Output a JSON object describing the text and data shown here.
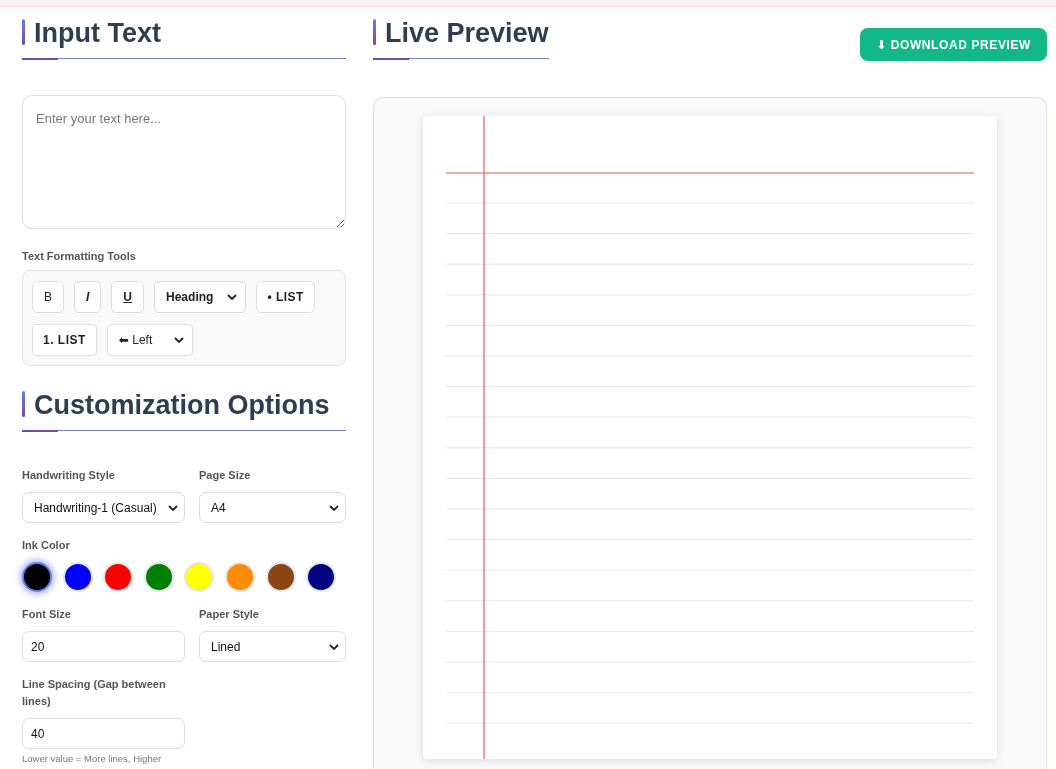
{
  "input_panel": {
    "title": "Input Text",
    "text_area": {
      "placeholder": "Enter your text here..."
    },
    "formatting": {
      "label": "Text Formatting Tools",
      "tools": [
        {
          "kind": "bold",
          "label": "B"
        },
        {
          "kind": "italic",
          "label": "I"
        },
        {
          "kind": "underline",
          "label": "U"
        },
        {
          "kind": "heading",
          "value": "Heading"
        },
        {
          "kind": "list",
          "label": "• LIST"
        },
        {
          "kind": "list",
          "label": "1. LIST"
        },
        {
          "kind": "align",
          "value": "⬅ Left"
        }
      ]
    }
  },
  "customization": {
    "title": "Customization Options",
    "handwriting_style": {
      "label": "Handwriting Style",
      "value": "Handwriting-1 (Casual)"
    },
    "page_size": {
      "label": "Page Size",
      "value": "A4"
    },
    "ink_color": {
      "label": "Ink Color",
      "swatches": [
        {
          "color": "#000000",
          "selected": true
        },
        {
          "color": "#0000ff",
          "selected": false
        },
        {
          "color": "#ff0000",
          "selected": false
        },
        {
          "color": "#008000",
          "selected": false
        },
        {
          "color": "#ffff00",
          "selected": false
        },
        {
          "color": "#ff8c00",
          "selected": false
        },
        {
          "color": "#8b4513",
          "selected": false
        },
        {
          "color": "#000080",
          "selected": false
        }
      ]
    },
    "font_size": {
      "label": "Font Size",
      "value": "20"
    },
    "paper_style": {
      "label": "Paper Style",
      "value": "Lined"
    },
    "line_spacing": {
      "label": "Line Spacing (Gap between lines)",
      "value": "40",
      "hint": "Lower value = More lines, Higher"
    }
  },
  "preview": {
    "title": "Live Preview",
    "download_button": "⬇ DOWNLOAD PREVIEW",
    "paper": {
      "kind": "lined"
    }
  }
}
